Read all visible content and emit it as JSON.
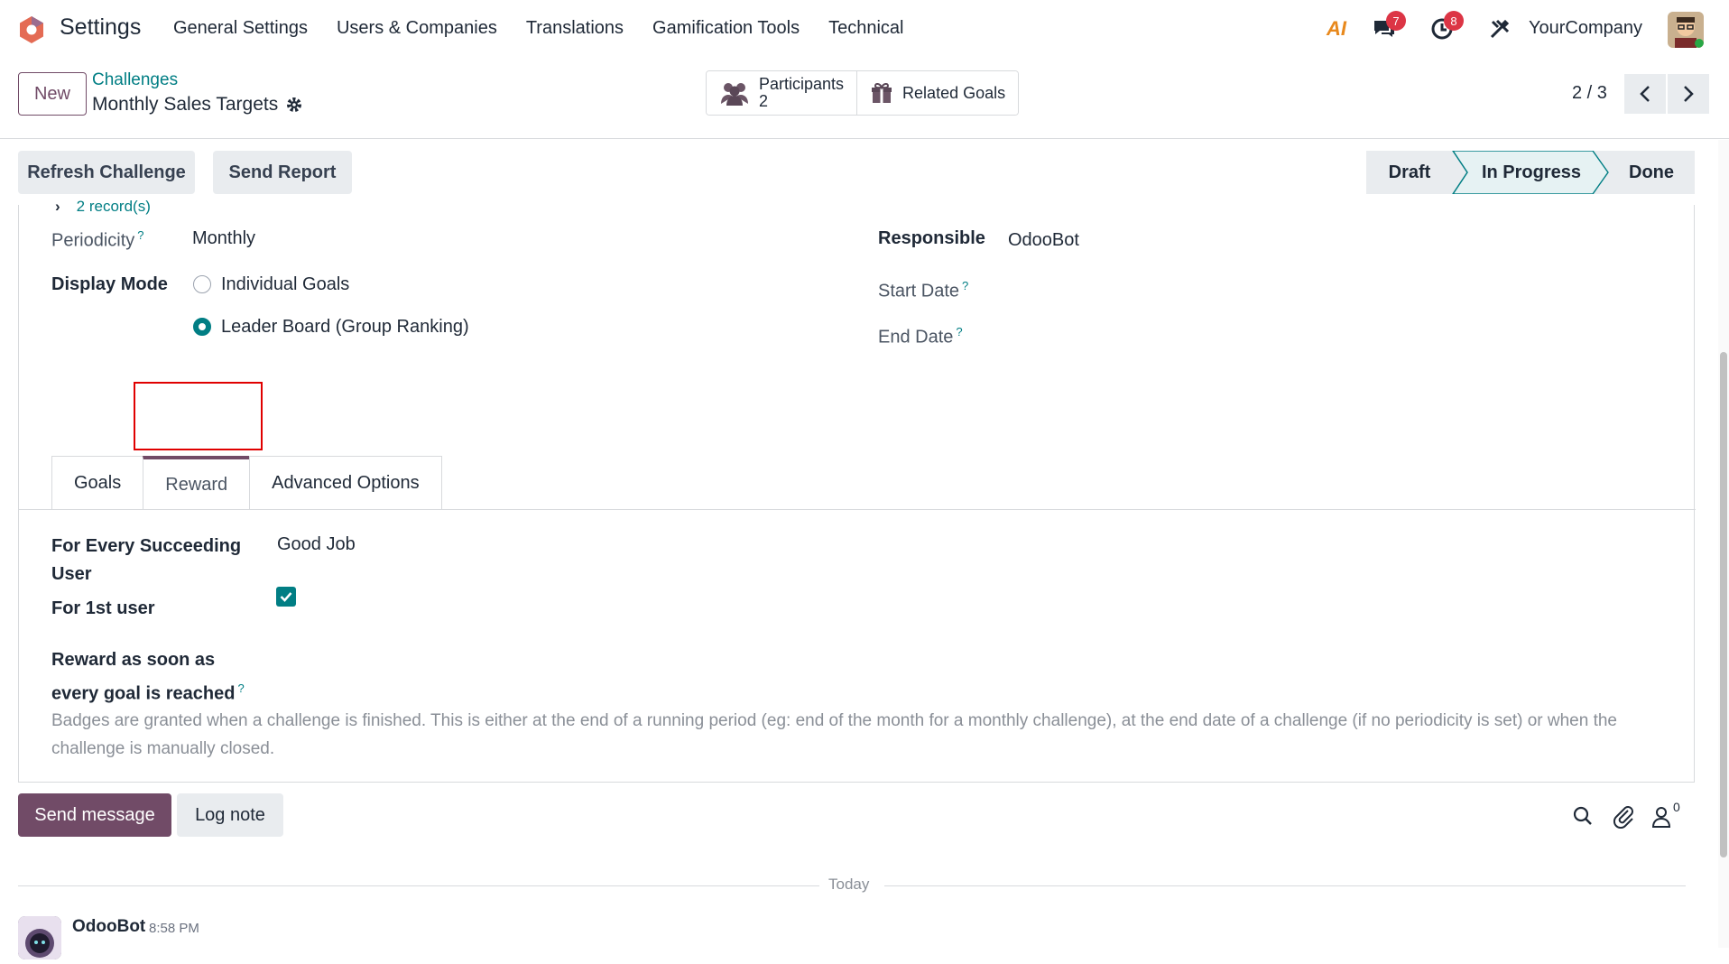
{
  "navbar": {
    "app_name": "Settings",
    "menu": [
      "General Settings",
      "Users & Companies",
      "Translations",
      "Gamification Tools",
      "Technical"
    ],
    "ai_label": "AI",
    "messages_count": "7",
    "activities_count": "8",
    "company": "YourCompany"
  },
  "control": {
    "new_label": "New",
    "breadcrumb_parent": "Challenges",
    "record_title": "Monthly Sales Targets",
    "participants_label": "Participants",
    "participants_count": "2",
    "related_goals_label": "Related Goals",
    "pager": "2 / 3"
  },
  "actions": {
    "refresh": "Refresh Challenge",
    "send_report": "Send Report"
  },
  "stages": [
    "Draft",
    "In Progress",
    "Done"
  ],
  "active_stage": "In Progress",
  "form": {
    "records_link": "2 record(s)",
    "periodicity_label": "Periodicity",
    "periodicity_value": "Monthly",
    "display_mode_label": "Display Mode",
    "display_mode_options": [
      "Individual Goals",
      "Leader Board (Group Ranking)"
    ],
    "display_mode_selected": "Leader Board (Group Ranking)",
    "responsible_label": "Responsible",
    "responsible_value": "OdooBot",
    "start_date_label": "Start Date",
    "end_date_label": "End Date",
    "help_mark": "?"
  },
  "tabs": [
    "Goals",
    "Reward",
    "Advanced Options"
  ],
  "active_tab": "Reward",
  "reward": {
    "every_user_label": "For Every Succeeding User",
    "every_user_value": "Good Job",
    "first_user_label": "For 1st user",
    "asap_label": "Reward as soon as every goal is reached",
    "asap_checked": true,
    "help_text": "Badges are granted when a challenge is finished. This is either at the end of a running period (eg: end of the month for a monthly challenge), at the end date of a challenge (if no periodicity is set) or when the challenge is manually closed."
  },
  "chatter": {
    "send_message": "Send message",
    "log_note": "Log note",
    "followers_count": "0",
    "today": "Today",
    "author": "OdooBot",
    "time": "8:58 PM"
  },
  "colors": {
    "brand": "#714b67",
    "accent": "#017e84",
    "badge": "#dc3545"
  }
}
